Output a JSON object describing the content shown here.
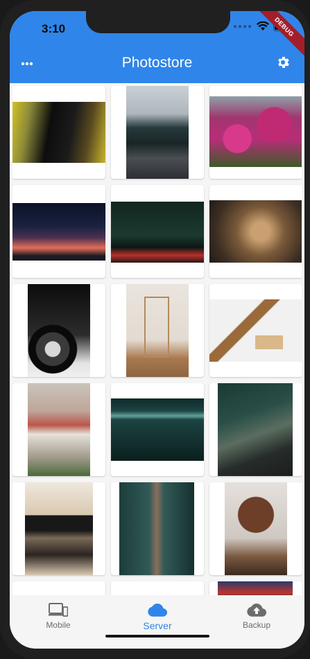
{
  "status_bar": {
    "time": "3:10"
  },
  "debug_banner": "DEBUG",
  "app_bar": {
    "title": "Photostore"
  },
  "bottom_nav": {
    "items": [
      {
        "label": "Mobile",
        "icon": "devices-icon"
      },
      {
        "label": "Server",
        "icon": "cloud-icon"
      },
      {
        "label": "Backup",
        "icon": "cloud-upload-icon"
      }
    ],
    "active_item": "Server"
  },
  "gallery": {
    "photo_tiles": 18
  },
  "colors": {
    "app_bar": "#2f85e9",
    "active_tab": "#2f85e9",
    "inactive_tab": "#6c6c6c",
    "debug_banner": "#a31e2a"
  }
}
